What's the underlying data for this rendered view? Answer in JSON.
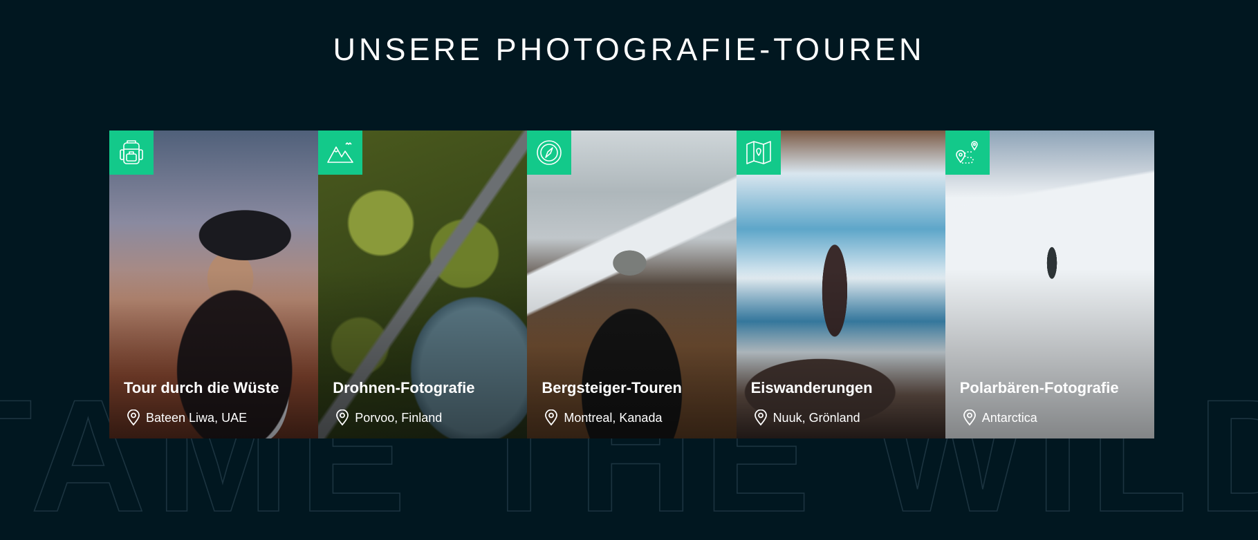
{
  "page": {
    "title": "UNSERE PHOTOGRAFIE-TOUREN",
    "background_word": "TAME THE WILD",
    "background_color": "#011720",
    "accent_color": "#13c98a"
  },
  "tours": [
    {
      "icon": "backpack-icon",
      "title": "Tour durch die Wüste",
      "location": "Bateen Liwa, UAE"
    },
    {
      "icon": "mountains-icon",
      "title": "Drohnen-Fotografie",
      "location": "Porvoo, Finland"
    },
    {
      "icon": "compass-icon",
      "title": "Bergsteiger-Touren",
      "location": "Montreal, Kanada"
    },
    {
      "icon": "map-icon",
      "title": "Eiswanderungen",
      "location": "Nuuk, Grönland"
    },
    {
      "icon": "route-icon",
      "title": "Polarbären-Fotografie",
      "location": "Antarctica"
    }
  ]
}
